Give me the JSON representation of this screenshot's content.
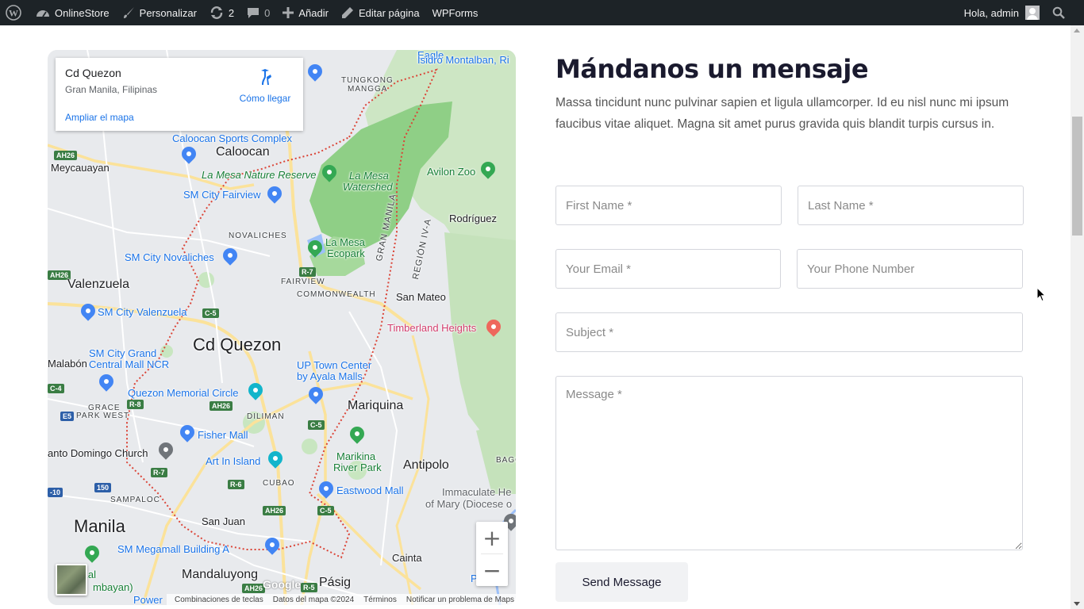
{
  "adminbar": {
    "site_name": "OnlineStore",
    "customize": "Personalizar",
    "updates_count": "2",
    "comments_count": "0",
    "new_label": "Añadir",
    "edit_page": "Editar página",
    "wpforms": "WPForms",
    "greeting": "Hola, admin"
  },
  "map": {
    "card": {
      "title": "Cd Quezon",
      "subtitle": "Gran Manila, Filipinas",
      "directions": "Cómo llegar",
      "enlarge": "Ampliar el mapa"
    },
    "labels": {
      "caloocan_sports": "Caloocan Sports Complex",
      "caloocan": "Caloocan",
      "meycauayan": "Meycauayan",
      "lamesa_reserve": "La Mesa Nature Reserve",
      "lamesa_watershed_1": "La Mesa",
      "lamesa_watershed_2": "Watershed",
      "sm_fairview": "SM City Fairview",
      "novaliches": "NOVALICHES",
      "lamesa_ecopark_1": "La Mesa",
      "lamesa_ecopark_2": "Ecopark",
      "sm_novaliches": "SM City Novaliches",
      "fairview": "FAIRVIEW",
      "commonwealth": "COMMONWEALTH",
      "valenzuela": "Valenzuela",
      "sm_valenzuela": "SM City Valenzuela",
      "cd_quezon": "Cd Quezon",
      "san_mateo": "San Mateo",
      "timberland": "Timberland Heights",
      "sm_grand_1": "SM City Grand",
      "sm_grand_2": "Central Mall NCR",
      "malabon": "Malabón",
      "up_town_1": "UP Town Center",
      "up_town_2": "by Ayala Malls",
      "quezon_memorial": "Quezon Memorial Circle",
      "mariquina": "Mariquina",
      "grace_park_1": "GRACE",
      "grace_park_2": "PARK WEST",
      "diliman": "DILIMAN",
      "fisher_mall": "Fisher Mall",
      "santo_domingo": "anto Domingo Church",
      "art_in_island": "Art In Island",
      "marikina_park_1": "Marikina",
      "marikina_park_2": "River Park",
      "antipolo": "Antipolo",
      "sampaloc": "SAMPALOC",
      "cubao": "CUBAO",
      "eastwood": "Eastwood Mall",
      "immaculate_1": "Immaculate He",
      "immaculate_2": "of Mary (Diocese o",
      "manila": "Manila",
      "san_juan": "San Juan",
      "sm_megamall": "SM Megamall Building A",
      "cainta": "Cainta",
      "rizal_1": "ng Rizal",
      "rizal_2": "mbayan)",
      "mandaluyong": "Mandaluyong",
      "pasig": "Pásig",
      "pinto": "Pintô",
      "power": "Power",
      "tungkong_1": "TUNGKONG",
      "tungkong_2": "MANGGA",
      "eagle_1": "Eagle",
      "isidro_1": "Isidro Montalban, Ri",
      "avilon": "Avilon Zoo",
      "rodriguez": "Rodríguez",
      "gran_manila": "GRAN MANILA",
      "region_iv": "REGIÓN IV-A",
      "bago": "BAGO"
    },
    "shields": {
      "ah26_a": "AH26",
      "ah26_b": "AH26",
      "ah26_c": "AH26",
      "ah26_d": "AH26",
      "ah26_e": "AH26",
      "r7_a": "R-7",
      "r7_b": "R-7",
      "c5_a": "C-5",
      "c5_b": "C-5",
      "c5_c": "C-5",
      "r8": "R-8",
      "r6": "R-6",
      "r5": "R-5",
      "c4": "C-4",
      "e5": "E5",
      "n150": "150",
      "n10": "-10"
    },
    "zoom_in": "+",
    "zoom_out": "−",
    "google": "Google",
    "attribution": {
      "shortcuts": "Combinaciones de teclas",
      "data": "Datos del mapa ©2024",
      "terms": "Términos",
      "report": "Notificar un problema de Maps"
    }
  },
  "form": {
    "heading": "Mándanos un mensaje",
    "intro": "Massa tincidunt nunc pulvinar sapien et ligula ullamcorper. Id eu nisl nunc mi ipsum faucibus vitae aliquet. Magna sit amet purus gravida quis blandit turpis cursus in.",
    "first_name_placeholder": "First Name *",
    "last_name_placeholder": "Last Name *",
    "email_placeholder": "Your Email *",
    "phone_placeholder": "Your Phone Number",
    "subject_placeholder": "Subject *",
    "message_placeholder": "Message *",
    "submit_label": "Send Message"
  },
  "colors": {
    "adminbar_bg": "#1d2327",
    "link_blue": "#1a73e8",
    "park_green": "#188038",
    "heading": "#1a1a2e"
  }
}
